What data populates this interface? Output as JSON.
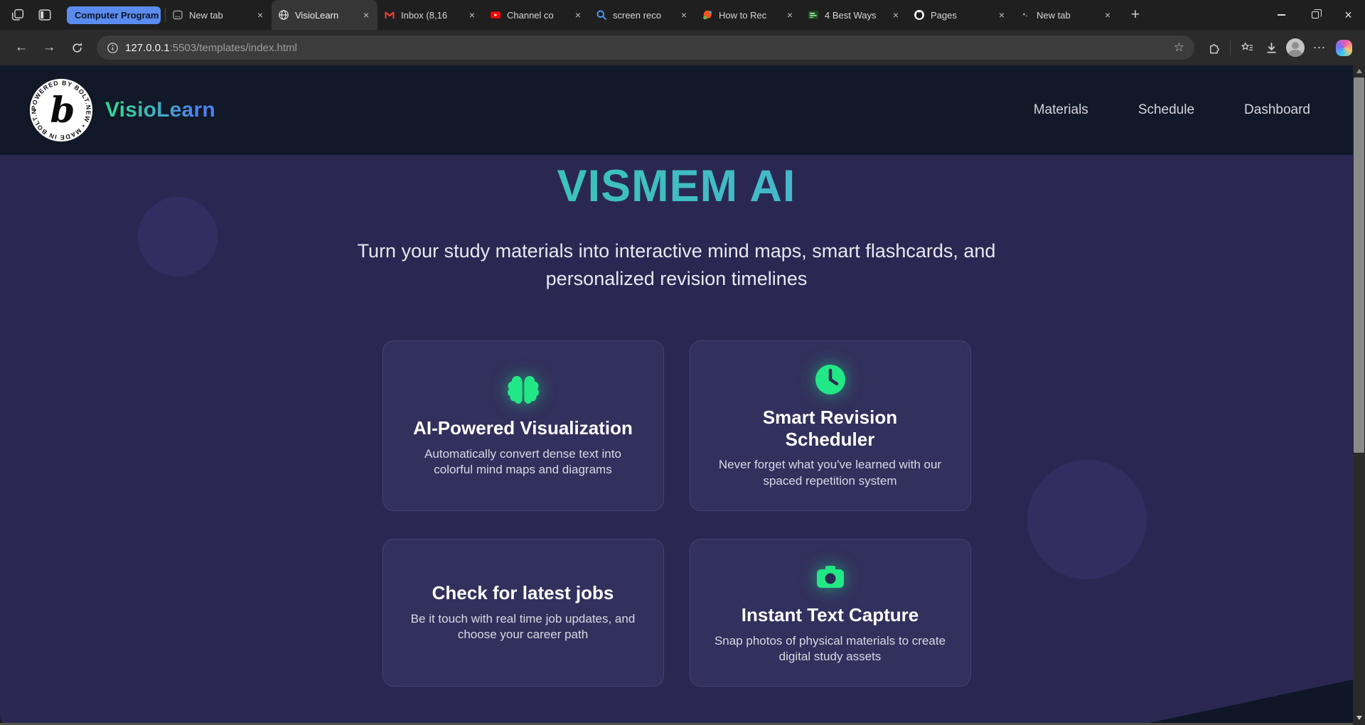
{
  "browser": {
    "tab_group": {
      "label": "Computer Program"
    },
    "tabs": [
      {
        "label": "New tab",
        "icon": "page-icon"
      },
      {
        "label": "VisioLearn",
        "icon": "globe-icon",
        "active": true
      },
      {
        "label": "Inbox (8,16",
        "icon": "gmail-icon"
      },
      {
        "label": "Channel co",
        "icon": "youtube-icon"
      },
      {
        "label": "screen reco",
        "icon": "search-icon"
      },
      {
        "label": "How to Rec",
        "icon": "site-icon"
      },
      {
        "label": "4 Best Ways",
        "icon": "thumbnail-icon"
      },
      {
        "label": "Pages",
        "icon": "github-icon"
      },
      {
        "label": "New tab",
        "icon": "dot-icon"
      }
    ],
    "new_tab_button": "+",
    "address": {
      "host": "127.0.0.1",
      "path": ":5503/templates/index.html"
    },
    "icons": {
      "close": "×",
      "back": "←",
      "forward": "→",
      "star": "☆",
      "more": "⋯"
    }
  },
  "site": {
    "header": {
      "brand": "VisioLearn",
      "badge": {
        "letter": "b",
        "ring_text": "POWERED BY BOLT.NEW • MADE IN BOLT.NEW •"
      },
      "nav": [
        {
          "label": "Materials"
        },
        {
          "label": "Schedule"
        },
        {
          "label": "Dashboard"
        }
      ]
    },
    "hero": {
      "title": "VISMEM AI",
      "subtitle": "Turn your study materials into interactive mind maps, smart flashcards, and personalized revision timelines"
    },
    "cards": [
      {
        "icon": "brain-icon",
        "title": "AI-Powered Visualization",
        "description": "Automatically convert dense text into colorful mind maps and diagrams"
      },
      {
        "icon": "clock-icon",
        "title": "Smart Revision Scheduler",
        "description": "Never forget what you've learned with our spaced repetition system"
      },
      {
        "icon": "",
        "title": "Check for latest jobs",
        "description": "Be it touch with real time job updates, and choose your career path"
      },
      {
        "icon": "camera-icon",
        "title": "Instant Text Capture",
        "description": "Snap photos of physical materials to create digital study assets"
      }
    ]
  },
  "colors": {
    "accent_green": "#22e786",
    "title_gradient_start": "#2bd8a0",
    "title_gradient_end": "#57a0e8",
    "header_bg": "#111827",
    "hero_bg": "#2a2852",
    "card_bg": "#32305c",
    "tab_group_blue": "#5a8cf0"
  }
}
